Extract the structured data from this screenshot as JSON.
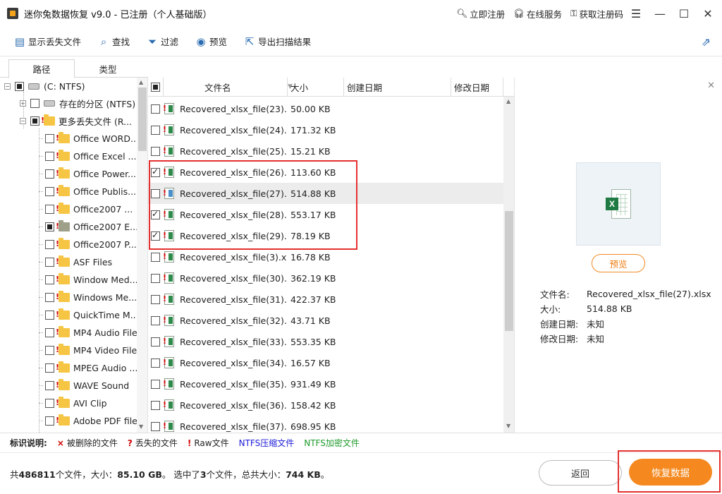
{
  "window": {
    "title": "迷你兔数据恢复  v9.0 - 已注册（个人基础版）",
    "links": [
      "立即注册",
      "在线服务",
      "获取注册码"
    ]
  },
  "toolbar": {
    "items": [
      {
        "label": "显示丢失文件",
        "icon": "file-list-icon"
      },
      {
        "label": "查找",
        "icon": "search-icon"
      },
      {
        "label": "过滤",
        "icon": "filter-icon"
      },
      {
        "label": "预览",
        "icon": "eye-icon"
      },
      {
        "label": "导出扫描结果",
        "icon": "export-icon"
      }
    ]
  },
  "tabs": [
    "路径",
    "类型"
  ],
  "tree": {
    "root": "(C: NTFS)",
    "existing": "存在的分区 (NTFS)",
    "lost": "更多丢失文件 (R...",
    "children": [
      {
        "label": "Office WORD...",
        "state": "none"
      },
      {
        "label": "Office Excel ...",
        "state": "none"
      },
      {
        "label": "Office Power...",
        "state": "none"
      },
      {
        "label": "Office Publis...",
        "state": "none"
      },
      {
        "label": "Office2007 ...",
        "state": "none"
      },
      {
        "label": "Office2007 E...",
        "state": "partial"
      },
      {
        "label": "Office2007 P...",
        "state": "none"
      },
      {
        "label": "ASF Files",
        "state": "none"
      },
      {
        "label": "Window Med...",
        "state": "none"
      },
      {
        "label": "Windows Me...",
        "state": "none"
      },
      {
        "label": "QuickTime M...",
        "state": "none"
      },
      {
        "label": "MP4 Audio File",
        "state": "none"
      },
      {
        "label": "MP4 Video File",
        "state": "none"
      },
      {
        "label": "MPEG Audio ...",
        "state": "none"
      },
      {
        "label": "WAVE Sound",
        "state": "none"
      },
      {
        "label": "AVI Clip",
        "state": "none"
      },
      {
        "label": "Adobe PDF file",
        "state": "none"
      }
    ]
  },
  "filelist": {
    "headers": {
      "name": "文件名",
      "size": "大小",
      "created": "创建日期",
      "modified": "修改日期"
    },
    "rows": [
      {
        "name": "Recovered_xlsx_file(23).x...",
        "size": "50.00 KB",
        "checked": false,
        "icon": "red"
      },
      {
        "name": "Recovered_xlsx_file(24).x...",
        "size": "171.32 KB",
        "checked": false,
        "icon": "red"
      },
      {
        "name": "Recovered_xlsx_file(25).x...",
        "size": "15.21 KB",
        "checked": false,
        "icon": "red"
      },
      {
        "name": "Recovered_xlsx_file(26).x...",
        "size": "113.60 KB",
        "checked": true,
        "icon": "red"
      },
      {
        "name": "Recovered_xlsx_file(27).x...",
        "size": "514.88 KB",
        "checked": false,
        "icon": "blue",
        "selected": true
      },
      {
        "name": "Recovered_xlsx_file(28).x...",
        "size": "553.17 KB",
        "checked": true,
        "icon": "red"
      },
      {
        "name": "Recovered_xlsx_file(29).x...",
        "size": "78.19 KB",
        "checked": true,
        "icon": "red"
      },
      {
        "name": "Recovered_xlsx_file(3).xlsx",
        "size": "16.78 KB",
        "checked": false,
        "icon": "red"
      },
      {
        "name": "Recovered_xlsx_file(30).x...",
        "size": "362.19 KB",
        "checked": false,
        "icon": "red"
      },
      {
        "name": "Recovered_xlsx_file(31).x...",
        "size": "422.37 KB",
        "checked": false,
        "icon": "red"
      },
      {
        "name": "Recovered_xlsx_file(32).x...",
        "size": "43.71 KB",
        "checked": false,
        "icon": "red"
      },
      {
        "name": "Recovered_xlsx_file(33).x...",
        "size": "553.35 KB",
        "checked": false,
        "icon": "red"
      },
      {
        "name": "Recovered_xlsx_file(34).x...",
        "size": "16.57 KB",
        "checked": false,
        "icon": "red"
      },
      {
        "name": "Recovered_xlsx_file(35).x...",
        "size": "931.49 KB",
        "checked": false,
        "icon": "red"
      },
      {
        "name": "Recovered_xlsx_file(36).x...",
        "size": "158.42 KB",
        "checked": false,
        "icon": "red"
      },
      {
        "name": "Recovered_xlsx_file(37).x...",
        "size": "698.95 KB",
        "checked": false,
        "icon": "red"
      }
    ]
  },
  "preview": {
    "button": "预览",
    "labels": {
      "name": "文件名:",
      "size": "大小:",
      "created": "创建日期:",
      "modified": "修改日期:"
    },
    "values": {
      "name": "Recovered_xlsx_file(27).xlsx",
      "size": "514.88 KB",
      "created": "未知",
      "modified": "未知"
    }
  },
  "legend": {
    "title": "标识说明:",
    "items": [
      {
        "mark": "×",
        "label": "被删除的文件",
        "color": "#d10000"
      },
      {
        "mark": "?",
        "label": "丢失的文件",
        "color": "#d10000"
      },
      {
        "mark": "!",
        "label": "Raw文件",
        "color": "#d10000"
      },
      {
        "mark": "",
        "label": "NTFS压缩文件",
        "color": "#1a1ad8"
      },
      {
        "mark": "",
        "label": "NTFS加密文件",
        "color": "#1e9a2a"
      }
    ]
  },
  "status": {
    "prefix": "共",
    "count": "486811",
    "mid1": "个文件，大小：",
    "total_size": "85.10 GB",
    "mid2": "。 选中了",
    "selected_count": "3",
    "mid3": "个文件，总共大小：",
    "selected_size": "744 KB",
    "suffix": "。"
  },
  "buttons": {
    "back": "返回",
    "recover": "恢复数据"
  }
}
